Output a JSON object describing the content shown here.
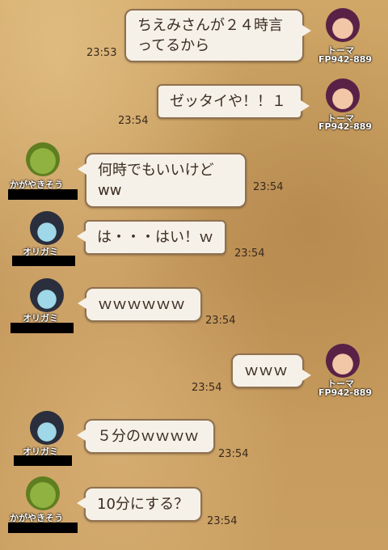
{
  "messages": [
    {
      "text": "ちえみさんが２４時言ってるから",
      "time": "23:53",
      "sender": "トーマ",
      "sender_id": "FP942-889"
    },
    {
      "text": "ゼッタイや！！１",
      "time": "23:54",
      "sender": "トーマ",
      "sender_id": "FP942-889"
    },
    {
      "text": "何時でもいいけどww",
      "time": "23:54",
      "sender": "かがやきそう"
    },
    {
      "text": "は・・・はい！ｗ",
      "time": "23:54",
      "sender": "オリガミ"
    },
    {
      "text": "ｗｗｗｗｗｗ",
      "time": "23:54",
      "sender": "オリガミ"
    },
    {
      "text": "ｗｗｗ",
      "time": "23:54",
      "sender": "トーマ",
      "sender_id": "FP942-889"
    },
    {
      "text": "５分のｗｗｗｗ",
      "time": "23:54",
      "sender": "オリガミ"
    },
    {
      "text": "10分にする？",
      "time": "23:54",
      "sender": "かがやきそう"
    }
  ],
  "icons": [
    "toma-avatar-icon",
    "origami-avatar-icon",
    "kagayakisou-avatar-icon"
  ]
}
